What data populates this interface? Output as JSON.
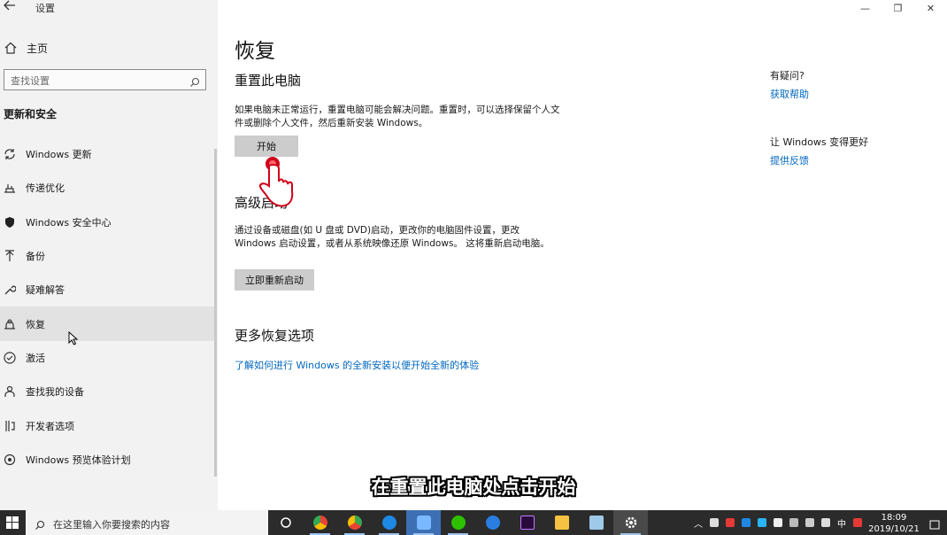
{
  "window": {
    "title": "设置"
  },
  "sidebar": {
    "home_label": "主页",
    "search_placeholder": "查找设置",
    "section_title": "更新和安全",
    "items": [
      {
        "label": "Windows 更新",
        "icon": "sync-icon"
      },
      {
        "label": "传递优化",
        "icon": "delivery-icon"
      },
      {
        "label": "Windows 安全中心",
        "icon": "shield-icon"
      },
      {
        "label": "备份",
        "icon": "backup-icon"
      },
      {
        "label": "疑难解答",
        "icon": "wrench-icon"
      },
      {
        "label": "恢复",
        "icon": "recovery-icon",
        "active": true
      },
      {
        "label": "激活",
        "icon": "check-circle-icon"
      },
      {
        "label": "查找我的设备",
        "icon": "person-icon"
      },
      {
        "label": "开发者选项",
        "icon": "dev-icon"
      },
      {
        "label": "Windows 预览体验计划",
        "icon": "insider-icon"
      }
    ]
  },
  "main": {
    "title": "恢复",
    "reset": {
      "heading": "重置此电脑",
      "text": "如果电脑未正常运行，重置电脑可能会解决问题。重置时，可以选择保留个人文件或删除个人文件，然后重新安装 Windows。",
      "button": "开始"
    },
    "advanced": {
      "heading": "高级启动",
      "text": "通过设备或磁盘(如 U 盘或 DVD)启动，更改你的电脑固件设置，更改 Windows 启动设置，或者从系统映像还原 Windows。 这将重新启动电脑。",
      "button": "立即重新启动"
    },
    "more": {
      "heading": "更多恢复选项",
      "link": "了解如何进行 Windows 的全新安装以便开始全新的体验"
    },
    "help": {
      "question": "有疑问?",
      "link": "获取帮助",
      "improve": "让 Windows 变得更好",
      "feedback_link": "提供反馈"
    }
  },
  "subtitle": "在重置此电脑处点击开始",
  "taskbar": {
    "search_placeholder": "在这里输入你要搜索的内容",
    "ime": "中",
    "time": "18:09",
    "date": "2019/10/21"
  },
  "colors": {
    "link": "#0067c0",
    "accent_red": "#d0021b"
  }
}
